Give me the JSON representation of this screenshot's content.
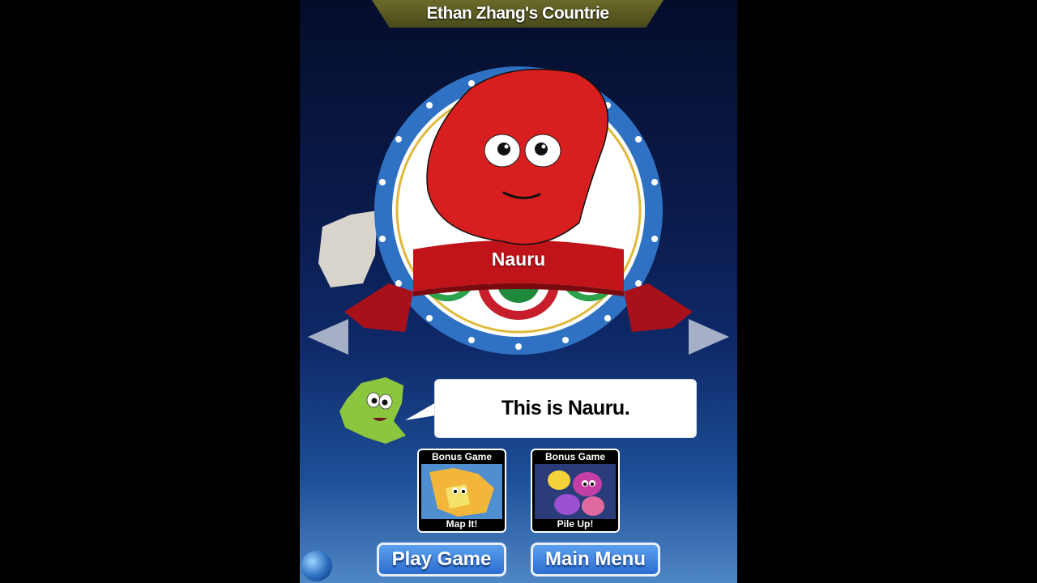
{
  "header": {
    "title": "Ethan Zhang's Countrie"
  },
  "country": {
    "name": "Nauru"
  },
  "speech": {
    "text": "This is Nauru."
  },
  "bonus_games": [
    {
      "top_label": "Bonus Game",
      "bottom_label": "Map It!"
    },
    {
      "top_label": "Bonus Game",
      "bottom_label": "Pile Up!"
    }
  ],
  "buttons": {
    "play": "Play Game",
    "menu": "Main Menu"
  },
  "icons": {
    "prev": "left-arrow-icon",
    "next": "right-arrow-icon",
    "globe": "globe-icon",
    "mascot": "canada-mascot-icon"
  },
  "colors": {
    "country_red": "#d81e1e",
    "ribbon_red": "#c0141a",
    "badge_blue": "#2f72c4",
    "button_blue": "#3d7fe0",
    "mascot_green": "#8cc63f"
  }
}
